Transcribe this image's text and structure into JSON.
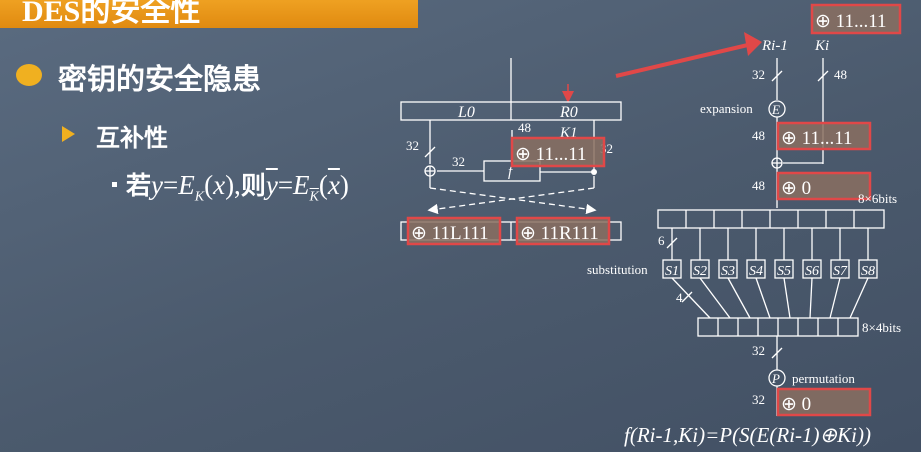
{
  "slide": {
    "title": "DES的安全性",
    "bullet1": "密钥的安全隐患",
    "bullet2": "互补性",
    "bullet3_prefix": "若",
    "bullet3_formula": "y=EK(x),则y=EK(x)"
  },
  "left_diagram": {
    "l0": "L0",
    "r0": "R0",
    "k1": "K1",
    "bits_32a": "32",
    "bits_48": "48",
    "bits_32b": "32",
    "bits_32c": "32",
    "f": "f",
    "key_box": "⊕ 11...11",
    "l1_box": "⊕ 11L111",
    "r1_box": "⊕ 11R111"
  },
  "right_diagram": {
    "top_box": "⊕ 11...11",
    "ri1": "Ri-1",
    "ki": "Ki",
    "bits_32": "32",
    "bits_48": "48",
    "expansion": "expansion",
    "e": "E",
    "bits_48b": "48",
    "xor_box1": "⊕ 11...11",
    "bits_48c": "48",
    "xor_box2": "⊕ 0",
    "grid1": "8×6bits",
    "bits_6": "6",
    "substitution": "substitution",
    "sboxes": [
      "S1",
      "S2",
      "S3",
      "S4",
      "S5",
      "S6",
      "S7",
      "S8"
    ],
    "bits_4": "4",
    "grid2": "8×4bits",
    "bits_32b": "32",
    "p": "P",
    "permutation": "permutation",
    "bits_32c": "32",
    "xor_box3": "⊕ 0",
    "formula": "f(Ri-1,Ki)=P(S(E(Ri-1)⊕Ki))"
  },
  "colors": {
    "accent": "#f0b020",
    "highlight": "#e04848",
    "background": "#4f5e72"
  }
}
